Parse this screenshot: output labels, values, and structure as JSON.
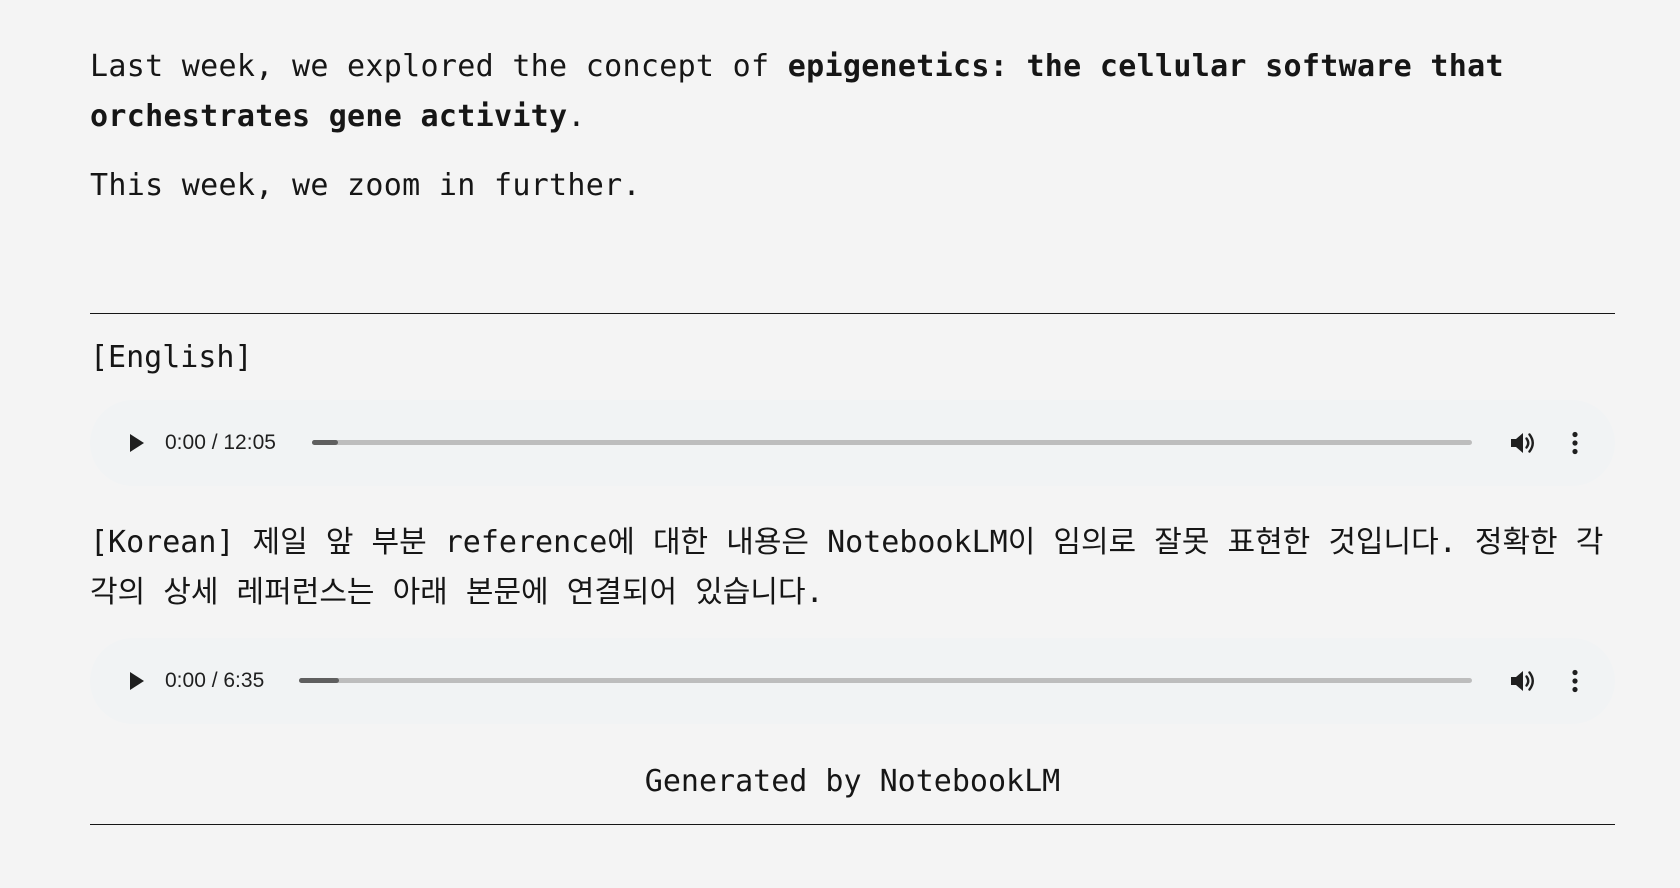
{
  "intro": {
    "p1_before": "Last week, we explored the concept of ",
    "p1_bold_line1": "epigenetics: the cellular software that",
    "p1_bold_line2": "orchestrates gene activity",
    "p1_after": ".",
    "p2": "This week, we zoom in further."
  },
  "english": {
    "label": "[English]",
    "player": {
      "time": "0:00 / 12:05",
      "progress": 0.0,
      "buffered": 0.022
    }
  },
  "korean": {
    "note": "[Korean] 제일 앞 부분 reference에 대한 내용은 NotebookLM이 임의로 잘못 표현한 것입니다. 정확한 각각의 상세 레퍼런스는 아래 본문에 연결되어 있습니다.",
    "player": {
      "time": "0:00 / 6:35",
      "progress": 0.0,
      "buffered": 0.034
    }
  },
  "footer": {
    "text": "Generated by NotebookLM"
  },
  "icons": {
    "play": "play-icon",
    "volume": "volume-icon",
    "more": "more-vertical-icon"
  },
  "colors": {
    "background": "#f4f4f4",
    "player_bg": "#f1f3f4",
    "text": "#161616"
  }
}
